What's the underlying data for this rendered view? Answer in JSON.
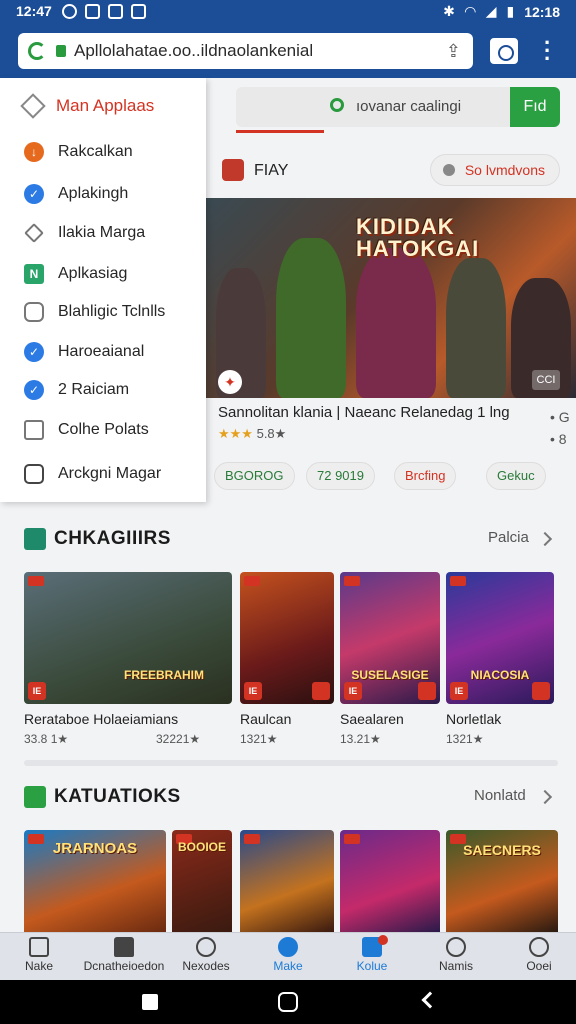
{
  "status": {
    "time_left": "12:47",
    "time_right": "12:18"
  },
  "browser": {
    "url": "Apllolahatae.oo..ildnaolankenial"
  },
  "drawer": {
    "title": "Man Applaas",
    "items": [
      {
        "label": "Rakcalkan",
        "icon": "orange-badge-icon"
      },
      {
        "label": "Aplakingh",
        "icon": "check-circle-icon"
      },
      {
        "label": "Ilakia Marga",
        "icon": "diamond-icon"
      },
      {
        "label": "Aplkasiag",
        "icon": "green-tile-icon"
      },
      {
        "label": "Blahligic Tclnlls",
        "icon": "people-icon"
      },
      {
        "label": "Haroeaianal",
        "icon": "check-circle-icon"
      },
      {
        "label": "2 Raiciam",
        "icon": "check-circle-icon"
      },
      {
        "label": "Colhe Polats",
        "icon": "checkbox-icon"
      },
      {
        "label": "Arckgni Magar",
        "icon": "chat-icon"
      }
    ]
  },
  "search": {
    "placeholder": "ıovanar caalingi",
    "button_label": "Fıd"
  },
  "featured": {
    "label": "FIAY",
    "pill_label": "So lvmdvons",
    "hero_title": "KIDIDAK HATOKGAI",
    "cc_label": "CCI",
    "game_name": "Sannolitan klania | Naeanc Relanedag 1 lng",
    "stars": "★★★",
    "rating": "5.8★",
    "side_top": "•  G",
    "side_bottom": "•  8"
  },
  "chips": [
    "BGOROG",
    "72 9019",
    "Brcfing",
    "Gekuc"
  ],
  "section1": {
    "title": "CHKAGIIIRS",
    "more": "Palcia",
    "items": [
      {
        "name": "Rerataboe Holaeiamians",
        "sub": "33.8 1★",
        "sub2": "32221★",
        "art": "FREEBRAHIM"
      },
      {
        "name": "Raulcan",
        "sub": "1321★",
        "art": ""
      },
      {
        "name": "Saealaren",
        "sub": "13.21★",
        "art": "SUSELASIGE"
      },
      {
        "name": "Norletlak",
        "sub": "1321★",
        "art": "NIACOSIA"
      }
    ]
  },
  "section2": {
    "title": "KATUATIOKS",
    "more": "Nonlatd",
    "items": [
      {
        "art": "JRARNOAS"
      },
      {
        "art": "BOOIOE"
      },
      {
        "art": ""
      },
      {
        "art": ""
      },
      {
        "art": "SAECNERS"
      }
    ]
  },
  "bottom_nav": [
    "Nake",
    "Dcnatheioedon",
    "Nexodes",
    "Make",
    "Kolue",
    "Namis",
    "Ooei"
  ]
}
